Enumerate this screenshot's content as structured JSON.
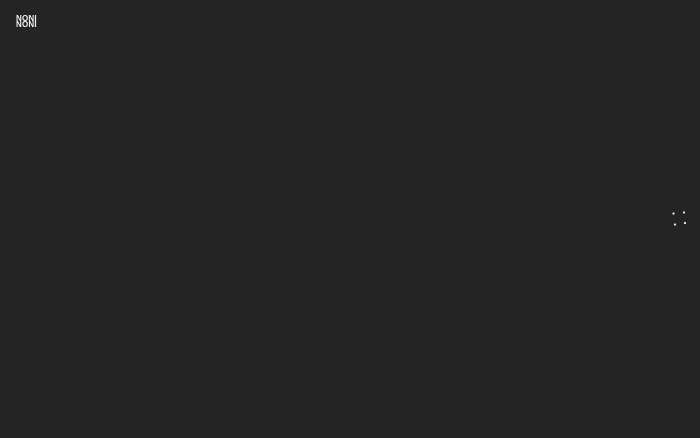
{
  "header": {
    "logo_line_1": "NONI",
    "logo_line_2": "NONI"
  },
  "menu": {
    "icon": "dots-menu-icon"
  },
  "colors": {
    "background": "#242424",
    "foreground": "#f2f2f2"
  }
}
